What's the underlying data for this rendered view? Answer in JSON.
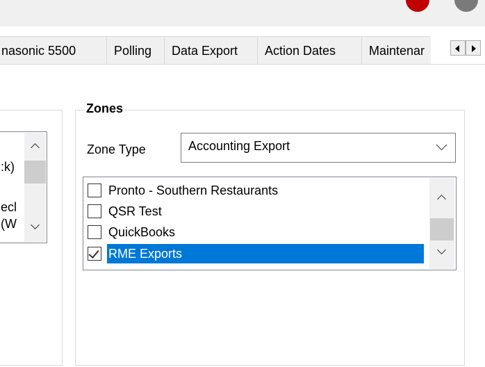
{
  "tabs": [
    {
      "label": "nasonic 5500"
    },
    {
      "label": "Polling"
    },
    {
      "label": "Data Export"
    },
    {
      "label": "Action Dates"
    },
    {
      "label": "Maintenar"
    }
  ],
  "left_list": {
    "items": [
      ":k)",
      "ecl",
      "(W"
    ]
  },
  "zones": {
    "title": "Zones",
    "zone_type_label": "Zone Type",
    "zone_type_value": "Accounting Export",
    "items": [
      {
        "label": "Pronto - Southern Restaurants",
        "checked": false,
        "selected": false
      },
      {
        "label": "QSR Test",
        "checked": false,
        "selected": false
      },
      {
        "label": "QuickBooks",
        "checked": false,
        "selected": false
      },
      {
        "label": "RME Exports",
        "checked": true,
        "selected": true
      }
    ]
  },
  "colors": {
    "selection": "#0078d7",
    "title_dot": "#c00000"
  }
}
